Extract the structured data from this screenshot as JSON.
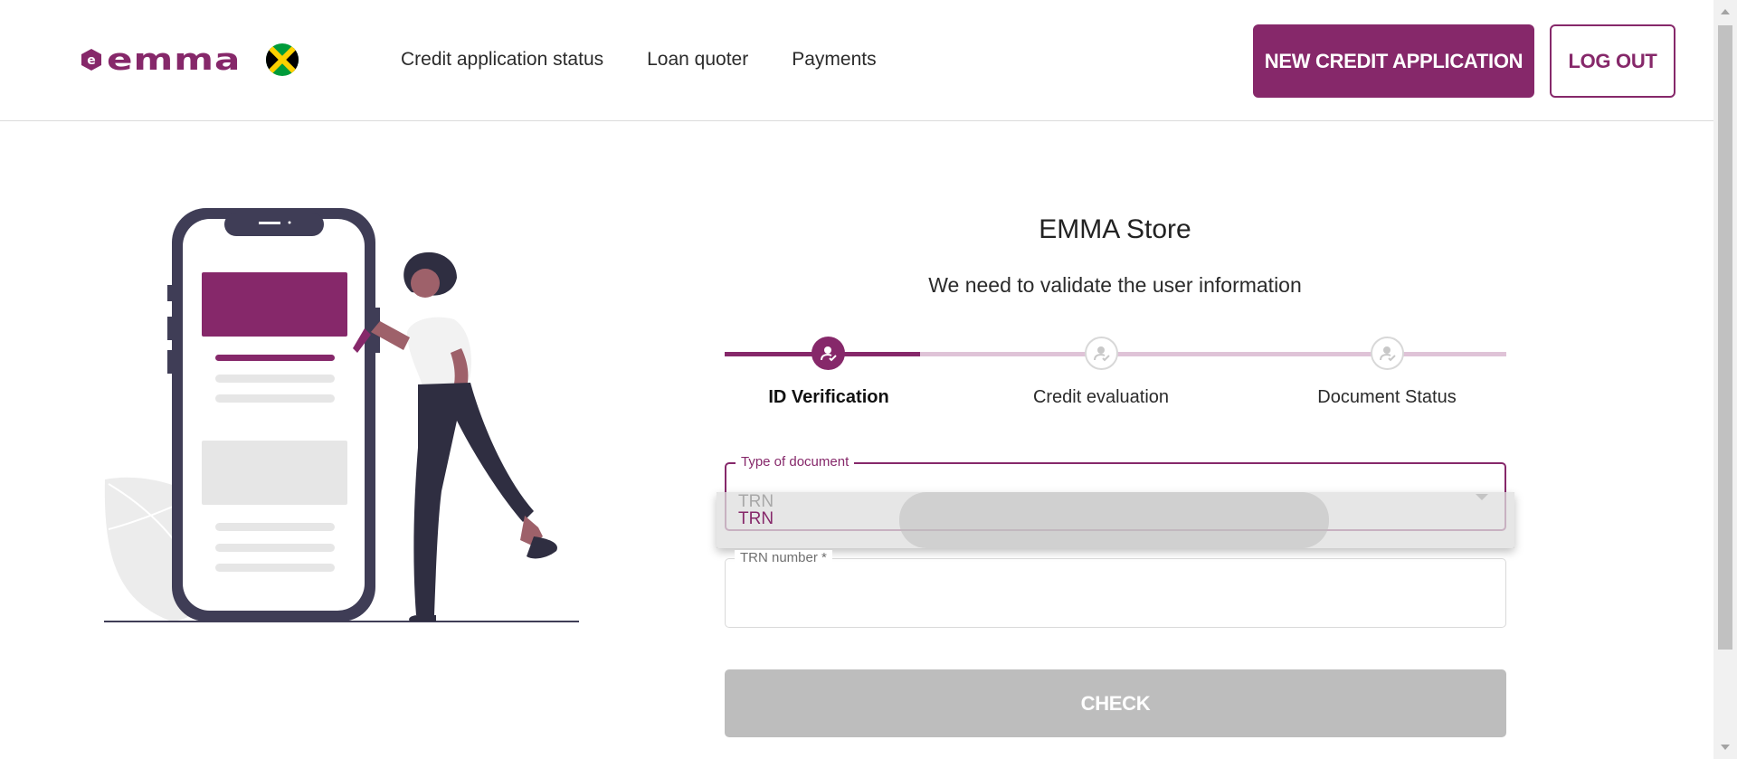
{
  "brand": {
    "name": "emma",
    "accent": "#86286a",
    "flag": "jamaica-flag"
  },
  "nav": {
    "items": [
      {
        "label": "Credit application status"
      },
      {
        "label": "Loan quoter"
      },
      {
        "label": "Payments"
      }
    ]
  },
  "header_actions": {
    "new_application_label": "NEW CREDIT APPLICATION",
    "logout_label": "LOG OUT"
  },
  "main": {
    "store_title": "EMMA Store",
    "subtitle": "We need to validate the user information",
    "steps": [
      {
        "label": "ID Verification",
        "state": "active",
        "icon": "user-check-icon"
      },
      {
        "label": "Credit evaluation",
        "state": "inactive",
        "icon": "user-check-icon"
      },
      {
        "label": "Document Status",
        "state": "inactive",
        "icon": "user-check-icon"
      }
    ],
    "document_type": {
      "label": "Type of document",
      "value": "TRN",
      "options": [
        "TRN"
      ]
    },
    "trn_number": {
      "label": "TRN number *",
      "value": ""
    },
    "check_label": "CHECK"
  }
}
